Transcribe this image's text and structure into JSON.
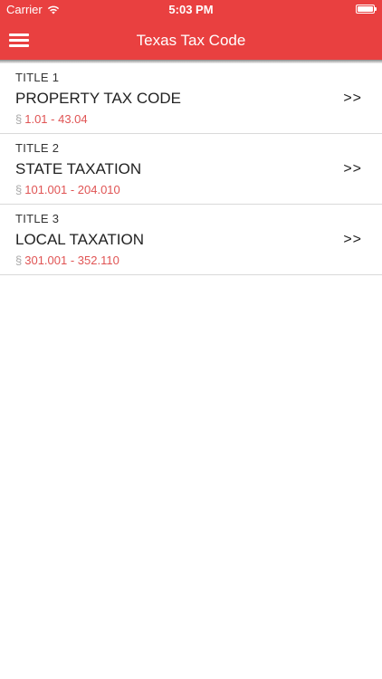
{
  "status_bar": {
    "carrier": "Carrier",
    "time": "5:03 PM",
    "battery_level": 1.0
  },
  "nav": {
    "title": "Texas Tax Code",
    "menu_icon": "hamburger-menu-icon"
  },
  "colors": {
    "accent": "#e94040",
    "range_text": "#e05454"
  },
  "titles": [
    {
      "number": "TITLE 1",
      "name": "PROPERTY TAX CODE",
      "section_sign": "§",
      "range": "1.01 - 43.04",
      "chevron": ">>"
    },
    {
      "number": "TITLE 2",
      "name": "STATE TAXATION",
      "section_sign": "§",
      "range": "101.001 - 204.010",
      "chevron": ">>"
    },
    {
      "number": "TITLE 3",
      "name": "LOCAL TAXATION",
      "section_sign": "§",
      "range": "301.001 - 352.110",
      "chevron": ">>"
    }
  ]
}
